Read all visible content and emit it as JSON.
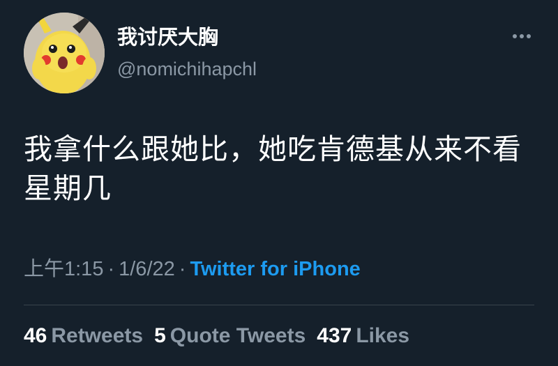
{
  "user": {
    "display_name": "我讨厌大胸",
    "handle": "@nomichihapchl",
    "avatar_icon": "pikachu-costume-avatar"
  },
  "menu": {
    "more_icon": "more-horizontal-icon"
  },
  "tweet": {
    "text": "我拿什么跟她比，她吃肯德基从来不看星期几",
    "time": "上午1:15",
    "separator": "·",
    "date": "1/6/22",
    "source": "Twitter for iPhone"
  },
  "stats": {
    "retweets_count": "46",
    "retweets_label": "Retweets",
    "quotes_count": "5",
    "quotes_label": "Quote Tweets",
    "likes_count": "437",
    "likes_label": "Likes"
  },
  "colors": {
    "background": "#15202b",
    "secondary_text": "#8b98a5",
    "link": "#1d9bf0",
    "divider": "#38444d"
  }
}
